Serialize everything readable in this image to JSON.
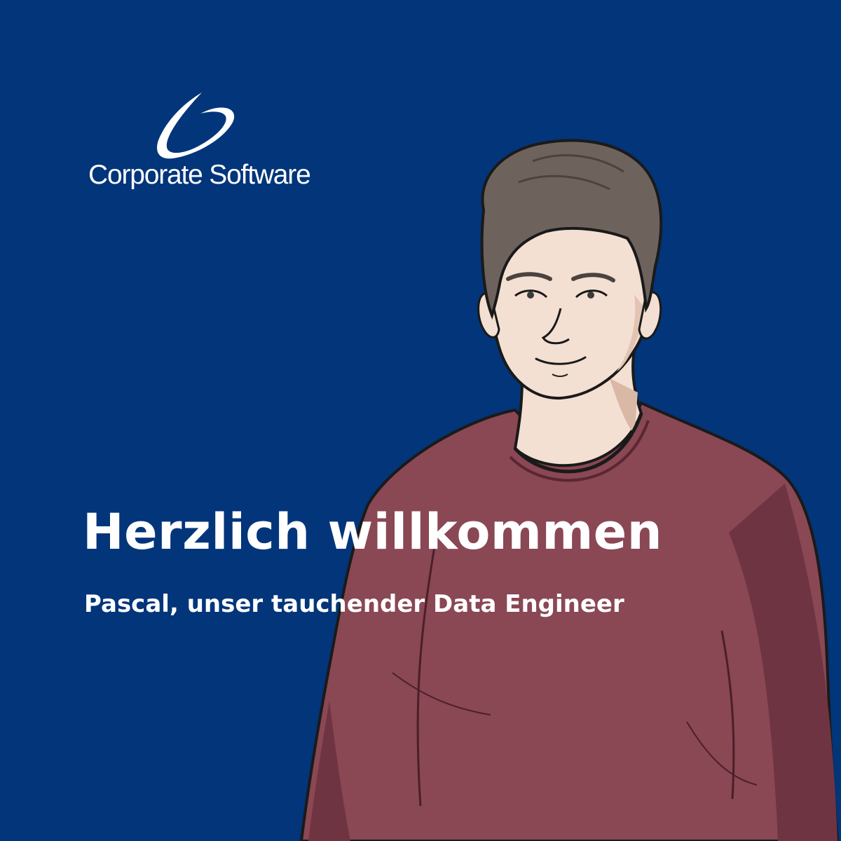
{
  "brand": {
    "name": "Corporate Software",
    "background_color": "#02357a",
    "logo_icon": "swoosh-logo-icon"
  },
  "main": {
    "headline": "Herzlich willkommen",
    "subline": "Pascal, unser tauchender Data Engineer"
  },
  "illustration": {
    "subject": "portrait-illustration",
    "sweater_color": "#8a4754",
    "hair_color": "#6e625c",
    "skin_color": "#f3e0d2"
  }
}
